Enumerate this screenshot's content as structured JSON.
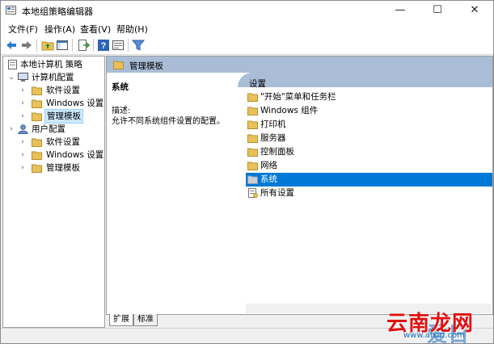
{
  "window": {
    "title": "本地组策略编辑器"
  },
  "controls": {
    "minimize": "—",
    "maximize": "☐",
    "close": "✕"
  },
  "menu": [
    {
      "label": "文件(F)"
    },
    {
      "label": "操作(A)"
    },
    {
      "label": "查看(V)"
    },
    {
      "label": "帮助(H)"
    }
  ],
  "tree": {
    "root": "本地计算机 策略",
    "computer_config": "计算机配置",
    "computer_children": [
      "软件设置",
      "Windows 设置",
      "管理模板"
    ],
    "user_config": "用户配置",
    "user_children": [
      "软件设置",
      "Windows 设置",
      "管理模板"
    ]
  },
  "right": {
    "header": "管理模板",
    "selected_title": "系统",
    "desc_label": "描述:",
    "desc_text": "允许不同系统组件设置的配置。",
    "column": "设置",
    "items": [
      {
        "label": "\"开始\"菜单和任务栏",
        "icon": "folder-icon"
      },
      {
        "label": "Windows 组件",
        "icon": "folder-icon"
      },
      {
        "label": "打印机",
        "icon": "folder-icon"
      },
      {
        "label": "服务器",
        "icon": "folder-icon"
      },
      {
        "label": "控制面板",
        "icon": "folder-icon"
      },
      {
        "label": "网络",
        "icon": "folder-icon"
      },
      {
        "label": "系统",
        "icon": "folder-icon",
        "selected": true
      },
      {
        "label": "所有设置",
        "icon": "all-settings-icon"
      }
    ]
  },
  "tabs": {
    "extended": "扩展",
    "standard": "标准"
  },
  "watermark": {
    "zh": "云南龙网",
    "en": "爱日",
    "url": "www.aixiri.com"
  },
  "colors": {
    "selection": "#0078d7",
    "header": "#a9bdd6",
    "folder": "#e8c15a"
  }
}
